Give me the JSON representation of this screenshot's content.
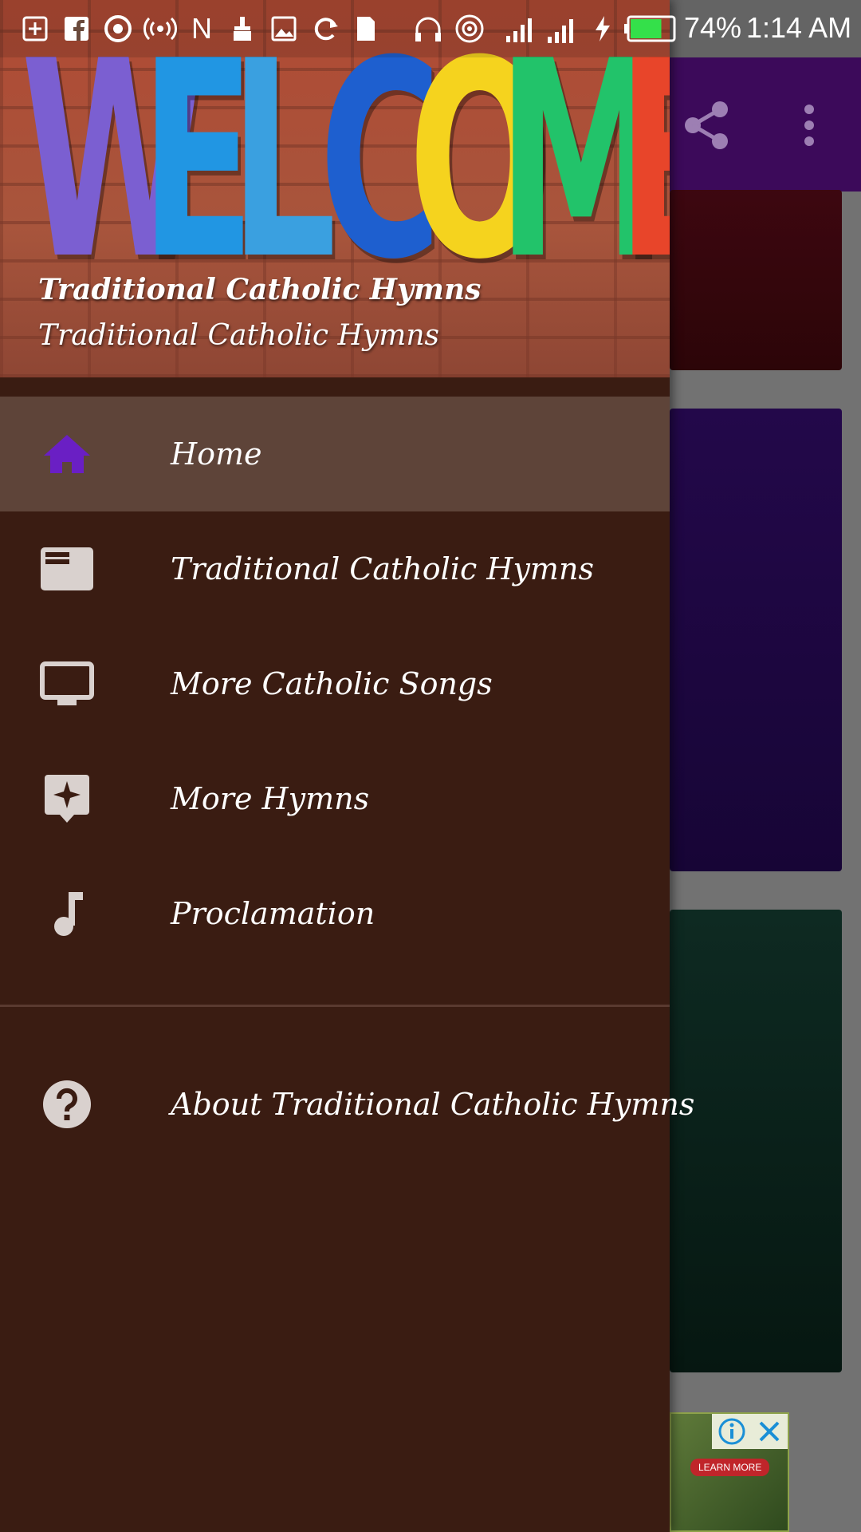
{
  "status_bar": {
    "icons": [
      "plus-box-icon",
      "facebook-icon",
      "chrome-icon",
      "broadcast-icon",
      "n-icon",
      "broom-icon",
      "image-icon",
      "sync-icon",
      "sim-icon",
      "headphones-icon",
      "hotspot-icon",
      "signal-icon",
      "signal-3g-icon",
      "charging-icon",
      "battery-icon"
    ],
    "battery_level_percent": 74,
    "battery_text": "74%",
    "time": "1:14 AM"
  },
  "toolbar": {
    "icons": [
      "share-icon",
      "more-vert-icon"
    ],
    "color": "#3c0a5a"
  },
  "drawer": {
    "header": {
      "art_letters": [
        "W",
        "E",
        "L",
        "C",
        "O",
        "M",
        "E"
      ],
      "art_colors": [
        "#7b5fd1",
        "#2196e3",
        "#3aa0e0",
        "#1e5fcf",
        "#f5d31e",
        "#22c36a",
        "#e8452a"
      ],
      "title": "Traditional Catholic Hymns",
      "subtitle": "Traditional Catholic Hymns"
    },
    "items": [
      {
        "label": "Home",
        "icon": "home-icon",
        "selected": true
      },
      {
        "label": "Traditional Catholic Hymns",
        "icon": "article-icon",
        "selected": false
      },
      {
        "label": "More Catholic Songs",
        "icon": "tv-icon",
        "selected": false
      },
      {
        "label": "More Hymns",
        "icon": "star-badge-icon",
        "selected": false
      },
      {
        "label": "Proclamation",
        "icon": "music-note-icon",
        "selected": false
      }
    ],
    "about": {
      "label": "About Traditional Catholic Hymns",
      "icon": "help-icon"
    }
  },
  "ad": {
    "cta": "LEARN MORE",
    "icons": [
      "info-icon",
      "close-icon"
    ]
  },
  "colors": {
    "drawer_bg": "#3a1c12",
    "selected_bg": "#5e4439",
    "home_icon": "#6a1fc4",
    "menu_icon": "#d9d1ce"
  }
}
